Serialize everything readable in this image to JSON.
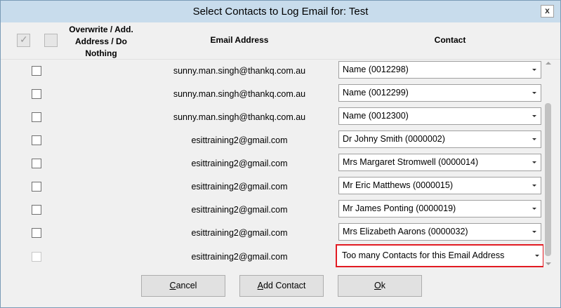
{
  "window": {
    "title": "Select Contacts to Log Email for: Test",
    "close_glyph": "x"
  },
  "header": {
    "overwrite": "Overwrite / Add. Address / Do Nothing",
    "email": "Email Address",
    "contact": "Contact"
  },
  "rows": [
    {
      "email": "sunny.man.singh@thankq.com.au",
      "contact": "Name (0012298)"
    },
    {
      "email": "sunny.man.singh@thankq.com.au",
      "contact": "Name (0012299)"
    },
    {
      "email": "sunny.man.singh@thankq.com.au",
      "contact": "Name (0012300)"
    },
    {
      "email": "esittraining2@gmail.com",
      "contact": "Dr Johny Smith (0000002)"
    },
    {
      "email": "esittraining2@gmail.com",
      "contact": "Mrs Margaret Stromwell (0000014)"
    },
    {
      "email": "esittraining2@gmail.com",
      "contact": "Mr Eric Matthews (0000015)"
    },
    {
      "email": "esittraining2@gmail.com",
      "contact": "Mr James Ponting (0000019)"
    },
    {
      "email": "esittraining2@gmail.com",
      "contact": "Mrs Elizabeth Aarons (0000032)"
    },
    {
      "email": "esittraining2@gmail.com",
      "contact": "Too many Contacts for this Email Address"
    }
  ],
  "buttons": {
    "cancel": {
      "first": "C",
      "rest": "ancel"
    },
    "add_contact": {
      "first": "A",
      "rest": "dd Contact"
    },
    "ok": {
      "first": "O",
      "rest": "k"
    }
  },
  "colors": {
    "titlebar": "#c8dcec",
    "highlight": "#e21b23"
  }
}
